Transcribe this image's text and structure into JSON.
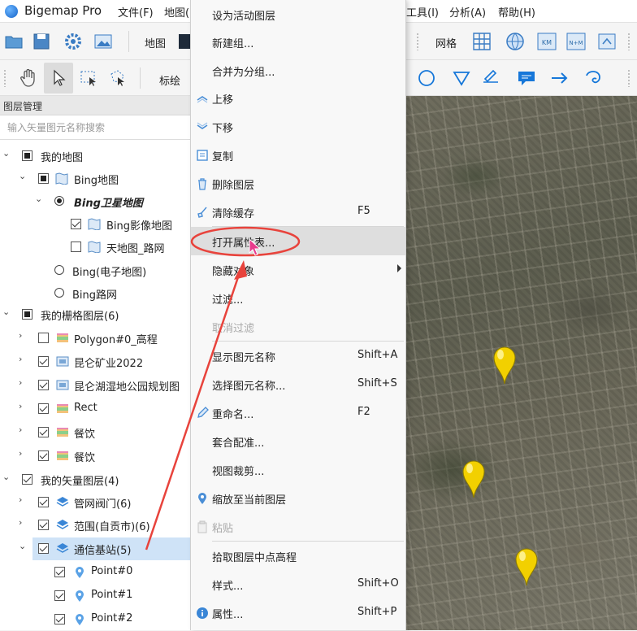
{
  "app": {
    "title": "Bigemap Pro"
  },
  "menubar": [
    "文件(F)",
    "地图(",
    "工具(I)",
    "分析(A)",
    "帮助(H)"
  ],
  "toolbar1": {
    "map_label": "地图",
    "grid_label": "网格"
  },
  "toolbar2": {
    "draw_label": "标绘"
  },
  "panel": {
    "header": "图层管理",
    "search_placeholder": "输入矢量图元名称搜索"
  },
  "tree": [
    {
      "label": "我的地图"
    },
    {
      "label": "Bing地图"
    },
    {
      "label": "Bing卫星地图"
    },
    {
      "label": "Bing影像地图"
    },
    {
      "label": "天地图_路网"
    },
    {
      "label": "Bing(电子地图)"
    },
    {
      "label": "Bing路网"
    },
    {
      "label": "我的栅格图层(6)"
    },
    {
      "label": "Polygon#0_高程"
    },
    {
      "label": "昆仑矿业2022"
    },
    {
      "label": "昆仑湖湿地公园规划图"
    },
    {
      "label": "Rect"
    },
    {
      "label": "餐饮"
    },
    {
      "label": "餐饮"
    },
    {
      "label": "我的矢量图层(4)"
    },
    {
      "label": "管网阀门(6)"
    },
    {
      "label": "范围(自贡市)(6)"
    },
    {
      "label": "通信基站(5)"
    },
    {
      "label": "Point#0"
    },
    {
      "label": "Point#1"
    },
    {
      "label": "Point#2"
    }
  ],
  "context_menu": [
    {
      "label": "设为活动图层",
      "shortcut": ""
    },
    {
      "label": "新建组...",
      "shortcut": ""
    },
    {
      "label": "合并为分组...",
      "shortcut": ""
    },
    {
      "label": "上移",
      "shortcut": "",
      "icon": "move-up-icon"
    },
    {
      "label": "下移",
      "shortcut": "",
      "icon": "move-down-icon"
    },
    {
      "label": "复制",
      "shortcut": "",
      "icon": "copy-icon"
    },
    {
      "label": "删除图层",
      "shortcut": "",
      "icon": "delete-icon"
    },
    {
      "label": "清除缓存",
      "shortcut": "F5",
      "icon": "clear-cache-icon"
    },
    {
      "label": "打开属性表...",
      "shortcut": ""
    },
    {
      "label": "隐藏对象",
      "shortcut": ""
    },
    {
      "label": "过滤...",
      "shortcut": ""
    },
    {
      "label": "取消过滤",
      "shortcut": "",
      "disabled": true
    },
    {
      "label": "显示图元名称",
      "shortcut": "Shift+A"
    },
    {
      "label": "选择图元名称...",
      "shortcut": "Shift+S"
    },
    {
      "label": "重命名...",
      "shortcut": "F2",
      "icon": "rename-icon"
    },
    {
      "label": "套合配准...",
      "shortcut": ""
    },
    {
      "label": "视图裁剪...",
      "shortcut": ""
    },
    {
      "label": "缩放至当前图层",
      "shortcut": "",
      "icon": "zoom-to-layer-icon"
    },
    {
      "label": "粘贴",
      "shortcut": "",
      "disabled": true,
      "icon": "paste-icon"
    },
    {
      "label": "拾取图层中点高程",
      "shortcut": ""
    },
    {
      "label": "样式...",
      "shortcut": "Shift+O"
    },
    {
      "label": "属性...",
      "shortcut": "Shift+P",
      "icon": "info-icon"
    }
  ],
  "colors": {
    "accent": "#1677d9",
    "annotation": "#e8433c",
    "selected_row": "#cfe3f7",
    "pin": "#f2d000"
  }
}
